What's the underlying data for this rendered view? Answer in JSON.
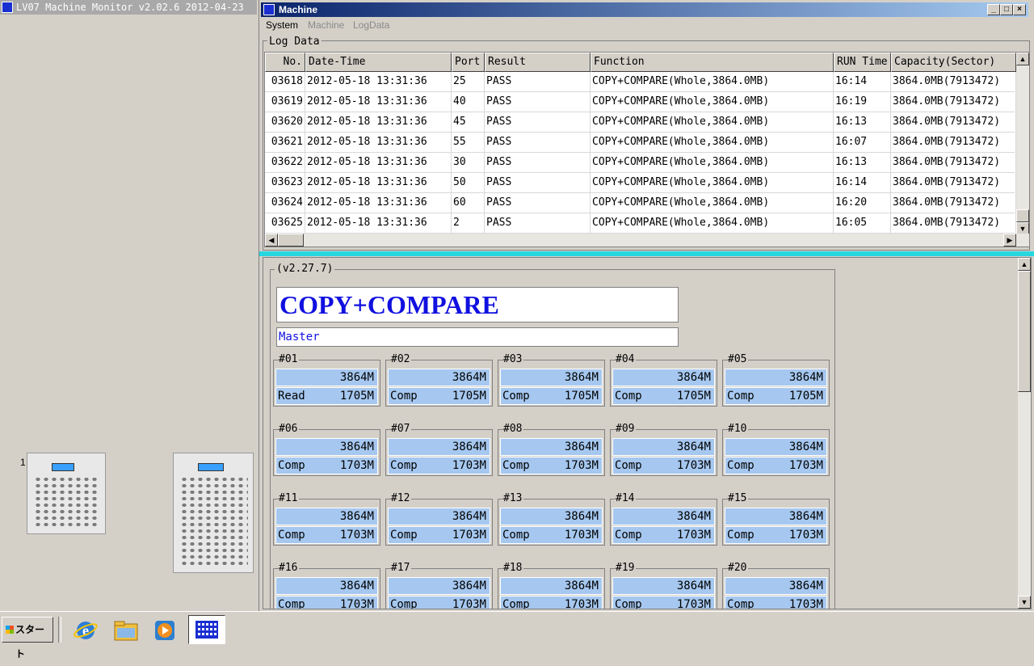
{
  "app": {
    "title": "LV07 Machine Monitor v2.02.6 2012-04-23",
    "device_label": "1"
  },
  "window": {
    "title": "Machine",
    "min": "_",
    "max": "□",
    "close": "×"
  },
  "menu": [
    "System",
    "Machine",
    "LogData"
  ],
  "logdata": {
    "legend": "Log Data",
    "columns": [
      "No.",
      "Date-Time",
      "Port",
      "Result",
      "Function",
      "RUN Time",
      "Capacity(Sector)"
    ],
    "rows": [
      [
        "03618",
        "2012-05-18 13:31:36",
        "25",
        "PASS",
        "COPY+COMPARE(Whole,3864.0MB)",
        "16:14",
        "3864.0MB(7913472)"
      ],
      [
        "03619",
        "2012-05-18 13:31:36",
        "40",
        "PASS",
        "COPY+COMPARE(Whole,3864.0MB)",
        "16:19",
        "3864.0MB(7913472)"
      ],
      [
        "03620",
        "2012-05-18 13:31:36",
        "45",
        "PASS",
        "COPY+COMPARE(Whole,3864.0MB)",
        "16:13",
        "3864.0MB(7913472)"
      ],
      [
        "03621",
        "2012-05-18 13:31:36",
        "55",
        "PASS",
        "COPY+COMPARE(Whole,3864.0MB)",
        "16:07",
        "3864.0MB(7913472)"
      ],
      [
        "03622",
        "2012-05-18 13:31:36",
        "30",
        "PASS",
        "COPY+COMPARE(Whole,3864.0MB)",
        "16:13",
        "3864.0MB(7913472)"
      ],
      [
        "03623",
        "2012-05-18 13:31:36",
        "50",
        "PASS",
        "COPY+COMPARE(Whole,3864.0MB)",
        "16:14",
        "3864.0MB(7913472)"
      ],
      [
        "03624",
        "2012-05-18 13:31:36",
        "60",
        "PASS",
        "COPY+COMPARE(Whole,3864.0MB)",
        "16:20",
        "3864.0MB(7913472)"
      ],
      [
        "03625",
        "2012-05-18 13:31:36",
        "2",
        "PASS",
        "COPY+COMPARE(Whole,3864.0MB)",
        "16:05",
        "3864.0MB(7913472)"
      ]
    ]
  },
  "status": {
    "version": "(v2.27.7)",
    "function": "COPY+COMPARE",
    "master": "Master"
  },
  "ports": [
    {
      "label": "#01",
      "cap": "3864M",
      "status": "Read",
      "size": "1705M"
    },
    {
      "label": "#02",
      "cap": "3864M",
      "status": "Comp",
      "size": "1705M"
    },
    {
      "label": "#03",
      "cap": "3864M",
      "status": "Comp",
      "size": "1705M"
    },
    {
      "label": "#04",
      "cap": "3864M",
      "status": "Comp",
      "size": "1705M"
    },
    {
      "label": "#05",
      "cap": "3864M",
      "status": "Comp",
      "size": "1705M"
    },
    {
      "label": "#06",
      "cap": "3864M",
      "status": "Comp",
      "size": "1703M"
    },
    {
      "label": "#07",
      "cap": "3864M",
      "status": "Comp",
      "size": "1703M"
    },
    {
      "label": "#08",
      "cap": "3864M",
      "status": "Comp",
      "size": "1703M"
    },
    {
      "label": "#09",
      "cap": "3864M",
      "status": "Comp",
      "size": "1703M"
    },
    {
      "label": "#10",
      "cap": "3864M",
      "status": "Comp",
      "size": "1703M"
    },
    {
      "label": "#11",
      "cap": "3864M",
      "status": "Comp",
      "size": "1703M"
    },
    {
      "label": "#12",
      "cap": "3864M",
      "status": "Comp",
      "size": "1703M"
    },
    {
      "label": "#13",
      "cap": "3864M",
      "status": "Comp",
      "size": "1703M"
    },
    {
      "label": "#14",
      "cap": "3864M",
      "status": "Comp",
      "size": "1703M"
    },
    {
      "label": "#15",
      "cap": "3864M",
      "status": "Comp",
      "size": "1703M"
    },
    {
      "label": "#16",
      "cap": "3864M",
      "status": "Comp",
      "size": "1703M"
    },
    {
      "label": "#17",
      "cap": "3864M",
      "status": "Comp",
      "size": "1703M"
    },
    {
      "label": "#18",
      "cap": "3864M",
      "status": "Comp",
      "size": "1703M"
    },
    {
      "label": "#19",
      "cap": "3864M",
      "status": "Comp",
      "size": "1703M"
    },
    {
      "label": "#20",
      "cap": "3864M",
      "status": "Comp",
      "size": "1703M"
    }
  ],
  "taskbar": {
    "start": "スタート",
    "icons": [
      "ie-icon",
      "explorer-icon",
      "media-player-icon",
      "machine-monitor-icon"
    ]
  },
  "colors": {
    "accent_bar": "#27d7e0",
    "port_cell": "#a6c8f0",
    "function_text": "#1010e0"
  }
}
